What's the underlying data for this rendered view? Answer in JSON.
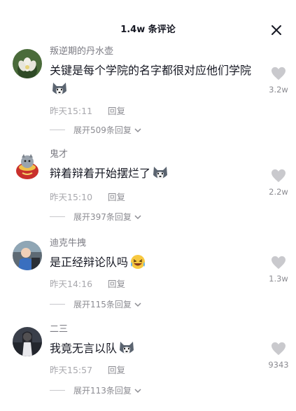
{
  "header": {
    "title": "1.4w 条评论"
  },
  "comments": [
    {
      "user": "叛逆期的丹水壶",
      "text": "关键是每个学院的名字都很对应他们学院",
      "time": "昨天15:11",
      "reply": "回复",
      "expand": "展开509条回复",
      "likes": "3.2w"
    },
    {
      "user": "鬼才",
      "text": "辩着辩着开始摆烂了",
      "time": "昨天15:10",
      "reply": "回复",
      "expand": "展开397条回复",
      "likes": "2.2w"
    },
    {
      "user": "迪克牛拽",
      "text": "是正经辩论队吗",
      "time": "昨天14:16",
      "reply": "回复",
      "expand": "展开115条回复",
      "likes": "1.3w"
    },
    {
      "user": "二三",
      "text": "我竟无言以队",
      "time": "昨天15:57",
      "reply": "回复",
      "expand": "展开113条回复",
      "likes": "9343"
    }
  ],
  "colors": {
    "text": "#161823",
    "secondary": "#8c8c92",
    "muted": "#a8a8ad",
    "heart": "#c9c9cd"
  },
  "icons": {
    "close": "close-icon",
    "like": "heart-icon",
    "expand": "chevron-down-icon",
    "emoji_dog": "husky-emoji",
    "emoji_laugh": "laughing-crying-emoji"
  }
}
